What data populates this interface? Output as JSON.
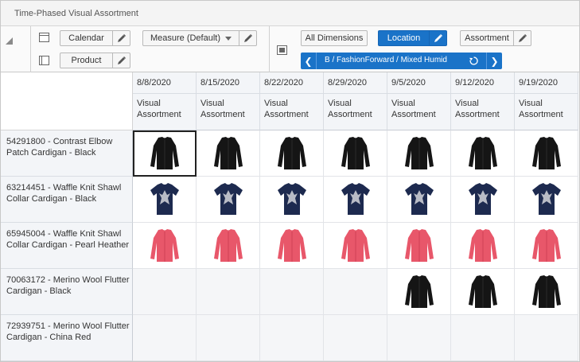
{
  "window": {
    "title": "Time-Phased Visual Assortment"
  },
  "toolbar": {
    "calendar_label": "Calendar",
    "product_label": "Product",
    "measure_label": "Measure (Default)",
    "all_dimensions_label": "All Dimensions",
    "location_label": "Location",
    "assortment_label": "Assortment",
    "breadcrumb_label": "B / FashionForward / Mixed Humid"
  },
  "grid": {
    "columns": [
      {
        "date": "8/8/2020",
        "measure": "Visual Assortment"
      },
      {
        "date": "8/15/2020",
        "measure": "Visual Assortment"
      },
      {
        "date": "8/22/2020",
        "measure": "Visual Assortment"
      },
      {
        "date": "8/29/2020",
        "measure": "Visual Assortment"
      },
      {
        "date": "9/5/2020",
        "measure": "Visual Assortment"
      },
      {
        "date": "9/12/2020",
        "measure": "Visual Assortment"
      },
      {
        "date": "9/19/2020",
        "measure": "Visual Assortment"
      }
    ],
    "rows": [
      {
        "label": "54291800 - Contrast Elbow Patch Cardigan - Black",
        "garment": "black-cardigan",
        "fill": [
          "#151515",
          "#151515",
          "#151515",
          "#151515",
          "#151515",
          "#151515",
          "#151515"
        ]
      },
      {
        "label": "63214451 - Waffle Knit Shawl Collar Cardigan - Black",
        "garment": "navy-fleur-tee",
        "fill": [
          "#1d2a4f",
          "#1d2a4f",
          "#1d2a4f",
          "#1d2a4f",
          "#1d2a4f",
          "#1d2a4f",
          "#1d2a4f"
        ]
      },
      {
        "label": "65945004 - Waffle Knit Shawl Collar Cardigan - Pearl Heather",
        "garment": "pink-cardigan",
        "fill": [
          "#e8576a",
          "#e8576a",
          "#e8576a",
          "#e8576a",
          "#e8576a",
          "#e8576a",
          "#e8576a"
        ]
      },
      {
        "label": "70063172 - Merino Wool Flutter Cardigan - Black",
        "garment": "black-cardigan",
        "fill": [
          "",
          "",
          "",
          "",
          "#151515",
          "#151515",
          "#151515"
        ]
      },
      {
        "label": "72939751 - Merino Wool Flutter Cardigan - China Red",
        "garment": "black-cardigan",
        "fill": [
          "",
          "",
          "",
          "",
          "",
          "",
          ""
        ]
      }
    ]
  },
  "colors": {
    "accent": "#1a73c8"
  }
}
